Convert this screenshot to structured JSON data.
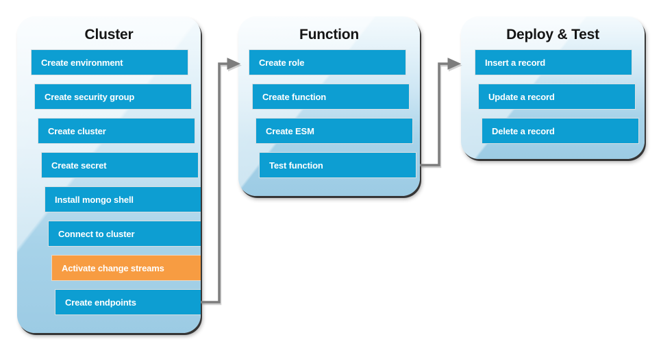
{
  "diagram": {
    "title": "Cluster / Function / Deploy & Test workflow",
    "background_color": "#ffffff",
    "colors": {
      "step": "#0d9ed2",
      "step_highlight": "#f79c42",
      "container_top": "#f4fafd",
      "container_bottom": "#9ccbe4",
      "connector": "#7d7d7d",
      "title_text": "#151515",
      "step_text": "#ffffff"
    }
  },
  "columns": [
    {
      "id": "cluster",
      "title": "Cluster",
      "steps": [
        {
          "label": "Create environment",
          "highlight": false
        },
        {
          "label": "Create security group",
          "highlight": false
        },
        {
          "label": "Create cluster",
          "highlight": false
        },
        {
          "label": "Create secret",
          "highlight": false
        },
        {
          "label": "Install mongo shell",
          "highlight": false
        },
        {
          "label": "Connect to cluster",
          "highlight": false
        },
        {
          "label": "Activate change streams",
          "highlight": true
        },
        {
          "label": "Create endpoints",
          "highlight": false
        }
      ]
    },
    {
      "id": "function",
      "title": "Function",
      "steps": [
        {
          "label": "Create role",
          "highlight": false
        },
        {
          "label": "Create function",
          "highlight": false
        },
        {
          "label": "Create ESM",
          "highlight": false
        },
        {
          "label": "Test function",
          "highlight": false
        }
      ]
    },
    {
      "id": "deploy-test",
      "title": "Deploy & Test",
      "steps": [
        {
          "label": "Insert a record",
          "highlight": false
        },
        {
          "label": "Update a record",
          "highlight": false
        },
        {
          "label": "Delete a record",
          "highlight": false
        }
      ]
    }
  ],
  "connectors": [
    {
      "id": "cluster-to-function",
      "from": "Create endpoints",
      "to": "Create role",
      "arrow": "arrow-right-icon"
    },
    {
      "id": "function-to-deploy-test",
      "from": "Test function",
      "to": "Insert a record",
      "arrow": "arrow-right-icon"
    }
  ]
}
